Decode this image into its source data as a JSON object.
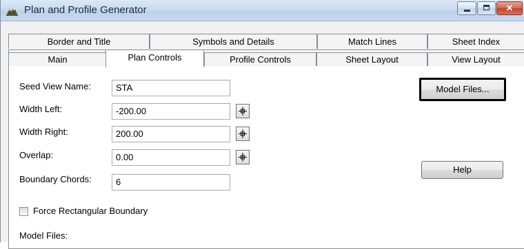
{
  "window": {
    "title": "Plan and Profile Generator",
    "icon": "plan-profile-app-icon",
    "caption_buttons": {
      "minimize": "minimize",
      "maximize": "maximize",
      "close": "✕"
    }
  },
  "tabs": {
    "row_top": [
      "Border and Title",
      "Symbols and Details",
      "Match Lines",
      "Sheet Index"
    ],
    "row_bottom": [
      "Main",
      "Plan Controls",
      "Profile Controls",
      "Sheet Layout",
      "View Layout"
    ],
    "selected": "Plan Controls"
  },
  "form": {
    "seed_view_name": {
      "label": "Seed View Name:",
      "value": "STA"
    },
    "width_left": {
      "label": "Width Left:",
      "value": "-200.00"
    },
    "width_right": {
      "label": "Width Right:",
      "value": "200.00"
    },
    "overlap": {
      "label": "Overlap:",
      "value": "0.00"
    },
    "boundary_chords": {
      "label": "Boundary Chords:",
      "value": "6"
    },
    "force_rectangular": {
      "label": "Force Rectangular Boundary",
      "checked": false
    },
    "model_files_label": "Model Files:"
  },
  "buttons": {
    "model_files": "Model Files...",
    "help": "Help"
  },
  "colors": {
    "titlebar": "#c9dbef",
    "panel_bg": "#ffffff",
    "dialog_bg": "#f0f0f0",
    "close_button": "#c2412a"
  }
}
